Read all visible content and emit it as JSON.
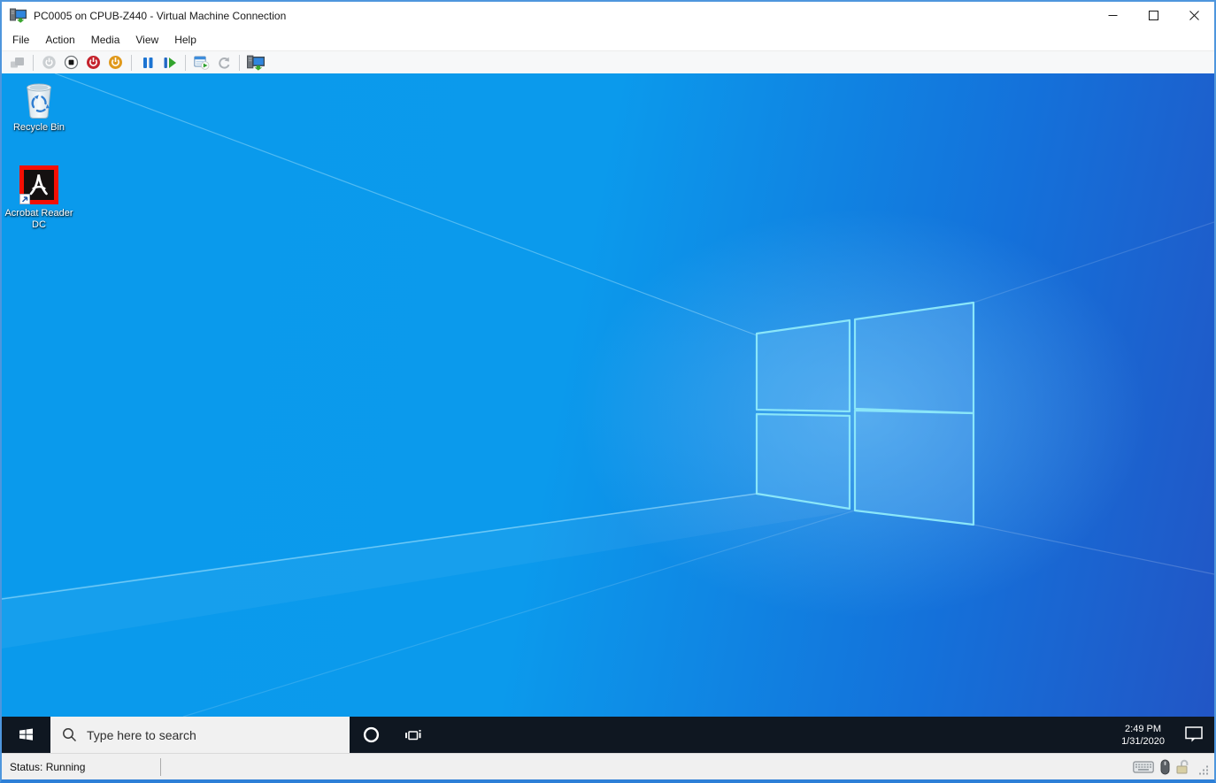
{
  "window": {
    "title": "PC0005 on CPUB-Z440 - Virtual Machine Connection",
    "border_color": "#4e96dd",
    "controls": [
      "minimize",
      "maximize",
      "close"
    ]
  },
  "menu_bar": {
    "items": [
      "File",
      "Action",
      "Media",
      "View",
      "Help"
    ]
  },
  "toolbar": {
    "buttons": [
      {
        "icon": "ctrl-alt-del-icon",
        "enabled": false
      },
      {
        "icon": "start-power-icon",
        "enabled": false
      },
      {
        "icon": "turn-off-icon",
        "enabled": true
      },
      {
        "icon": "shut-down-icon",
        "enabled": true,
        "color": "#c5242e"
      },
      {
        "icon": "save-state-icon",
        "enabled": true,
        "color": "#e0991c"
      },
      {
        "icon": "pause-icon",
        "enabled": true,
        "color": "#1c74d2"
      },
      {
        "icon": "reset-icon",
        "enabled": true,
        "color": "#33a42e"
      },
      {
        "icon": "checkpoint-icon",
        "enabled": true
      },
      {
        "icon": "revert-icon",
        "enabled": false
      },
      {
        "icon": "enhanced-session-icon",
        "enabled": true
      }
    ]
  },
  "desktop": {
    "icons": [
      {
        "label": "Recycle Bin"
      },
      {
        "label": "Acrobat Reader DC"
      }
    ],
    "wallpaper": {
      "left_color": "#0a9aec",
      "right_top_color": "#2255c5",
      "logo_stroke": "#8ae6f9"
    }
  },
  "taskbar": {
    "color": "#0f1721",
    "search": {
      "placeholder": "Type here to search",
      "value": ""
    },
    "icons": [
      "start-icon",
      "search-icon",
      "cortana-icon",
      "task-view-icon",
      "action-center-icon"
    ],
    "clock": {
      "time": "2:49 PM",
      "date": "1/31/2020"
    }
  },
  "status_bar": {
    "text": "Status: Running",
    "icons": [
      "keyboard-icon",
      "mouse-icon",
      "lock-icon",
      "resize-grip"
    ]
  }
}
